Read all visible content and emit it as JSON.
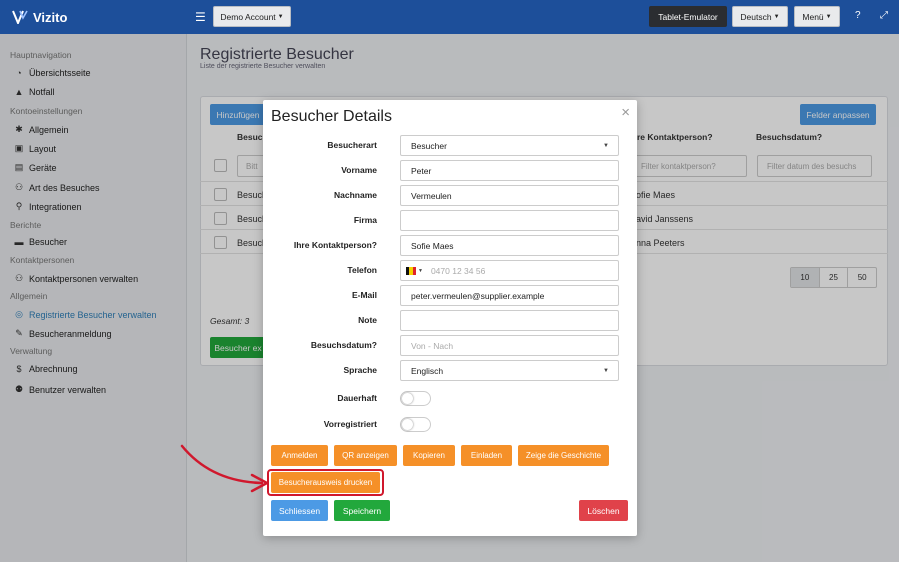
{
  "topbar": {
    "brand": "Vizito",
    "demo_account": "Demo Account",
    "tablet_emulator": "Tablet-Emulator",
    "language": "Deutsch",
    "menu": "Menü"
  },
  "sidebar": {
    "sections": [
      {
        "head": "Hauptnavigation",
        "items": [
          {
            "label": "Übersichtsseite",
            "icon": "dashboard-icon"
          },
          {
            "label": "Notfall",
            "icon": "warning-icon"
          }
        ]
      },
      {
        "head": "Kontoeinstellungen",
        "items": [
          {
            "label": "Allgemein",
            "icon": "gear-icon"
          },
          {
            "label": "Layout",
            "icon": "image-icon"
          },
          {
            "label": "Geräte",
            "icon": "tablet-icon"
          },
          {
            "label": "Art des Besuches",
            "icon": "users-icon"
          },
          {
            "label": "Integrationen",
            "icon": "plug-icon"
          }
        ]
      },
      {
        "head": "Berichte",
        "items": [
          {
            "label": "Besucher",
            "icon": "book-icon"
          }
        ]
      },
      {
        "head": "Kontaktpersonen",
        "items": [
          {
            "label": "Kontaktpersonen verwalten",
            "icon": "users-icon"
          }
        ]
      },
      {
        "head": "Allgemein",
        "items": [
          {
            "label": "Registrierte Besucher verwalten",
            "icon": "target-icon",
            "active": true
          },
          {
            "label": "Besucheranmeldung",
            "icon": "pencil-icon"
          }
        ]
      },
      {
        "head": "Verwaltung",
        "items": [
          {
            "label": "Abrechnung",
            "icon": "dollar-icon"
          },
          {
            "label": "Benutzer verwalten",
            "icon": "user-plus-icon"
          }
        ]
      }
    ]
  },
  "page": {
    "title": "Registrierte Besucher",
    "subtitle": "Liste der registrierte Besucher verwalten"
  },
  "table": {
    "add_button": "Hinzufügen",
    "fields_button": "Felder anpassen",
    "col_visitor": "Besuch",
    "col_contact": "re Kontaktperson?",
    "col_date": "Besuchsdatum?",
    "filter_contact": "Filter kontaktperson?",
    "filter_date": "Filter datum des besuchs",
    "filter_first": "Bitt",
    "rows": [
      {
        "a": "Besuch",
        "b": "ofie Maes"
      },
      {
        "a": "Besuch",
        "b": "avid Janssens"
      },
      {
        "a": "Besuch",
        "b": "nna Peeters"
      }
    ],
    "page_sizes": [
      "10",
      "25",
      "50"
    ],
    "total": "Gesamt: 3",
    "export_button": "Besucher ex"
  },
  "modal": {
    "title": "Besucher Details",
    "close": "×",
    "fields": {
      "besucherart": {
        "label": "Besucherart",
        "value": "Besucher"
      },
      "vorname": {
        "label": "Vorname",
        "value": "Peter"
      },
      "nachname": {
        "label": "Nachname",
        "value": "Vermeulen"
      },
      "firma": {
        "label": "Firma",
        "value": ""
      },
      "kontakt": {
        "label": "Ihre Kontaktperson?",
        "value": "Sofie Maes"
      },
      "telefon": {
        "label": "Telefon",
        "placeholder": "0470 12 34 56"
      },
      "email": {
        "label": "E-Mail",
        "value": "peter.vermeulen@supplier.example"
      },
      "note": {
        "label": "Note",
        "value": ""
      },
      "datum": {
        "label": "Besuchsdatum?",
        "placeholder": "Von - Nach"
      },
      "sprache": {
        "label": "Sprache",
        "value": "Englisch"
      },
      "dauerhaft": {
        "label": "Dauerhaft"
      },
      "vorregistriert": {
        "label": "Vorregistriert"
      }
    },
    "actions": {
      "anmelden": "Anmelden",
      "qr": "QR anzeigen",
      "kopieren": "Kopieren",
      "einladen": "Einladen",
      "geschichte": "Zeige die Geschichte",
      "ausweis": "Besucherausweis drucken",
      "schliessen": "Schliessen",
      "speichern": "Speichern",
      "loeschen": "Löschen"
    }
  },
  "colors": {
    "topbar": "#1d4f9a",
    "orange": "#f59028",
    "blue": "#4c9ae5",
    "green": "#22a83c",
    "red": "#e0424a",
    "highlight": "#d0182d"
  }
}
